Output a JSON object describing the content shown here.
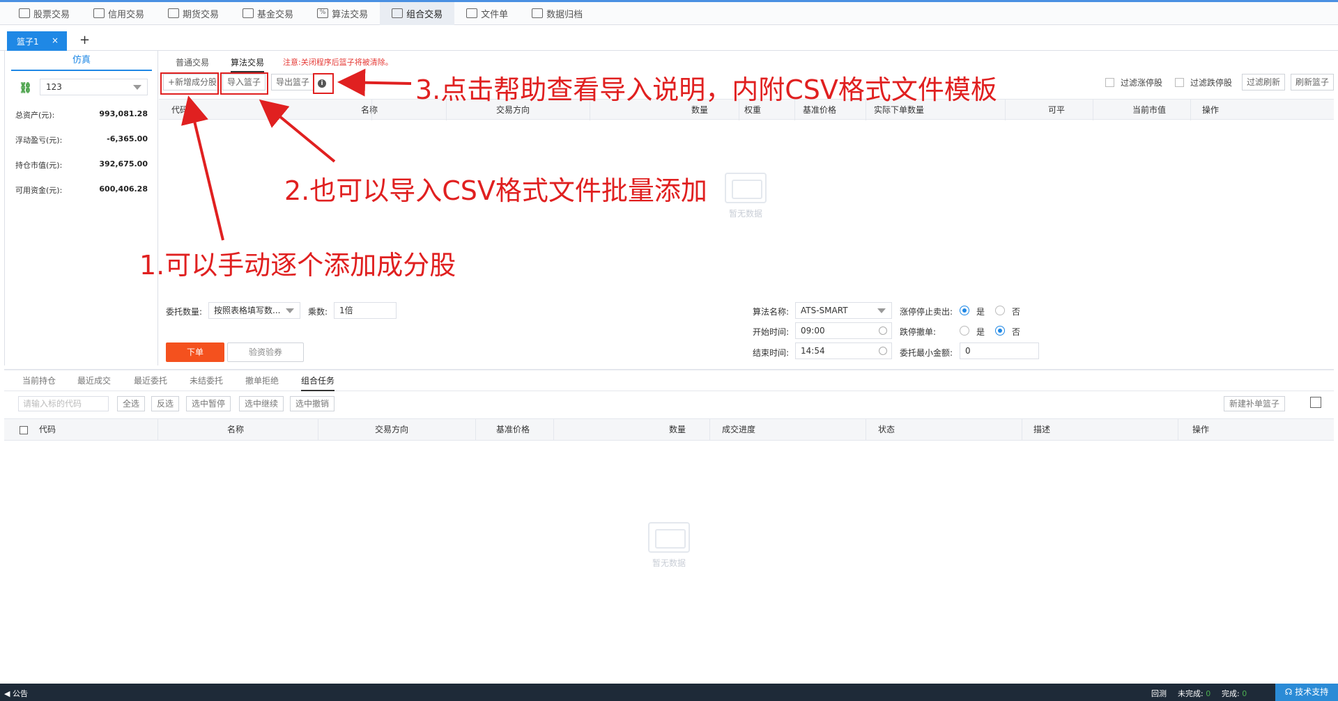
{
  "topnav": [
    {
      "label": "股票交易",
      "icon": "stock-icon"
    },
    {
      "label": "信用交易",
      "icon": "credit-card-icon"
    },
    {
      "label": "期货交易",
      "icon": "futures-chart-icon"
    },
    {
      "label": "基金交易",
      "icon": "fund-chart-icon"
    },
    {
      "label": "算法交易",
      "icon": "percent-icon"
    },
    {
      "label": "组合交易",
      "icon": "basket-icon",
      "active": true
    },
    {
      "label": "文件单",
      "icon": "file-icon"
    },
    {
      "label": "数据归档",
      "icon": "layers-icon"
    }
  ],
  "basket_tab": {
    "label": "篮子1",
    "close": "×",
    "add": "+"
  },
  "left": {
    "title": "仿真",
    "account": "123",
    "stats": [
      {
        "label": "总资产(元):",
        "value": "993,081.28"
      },
      {
        "label": "浮动盈亏(元):",
        "value": "-6,365.00"
      },
      {
        "label": "持仓市值(元):",
        "value": "392,675.00"
      },
      {
        "label": "可用资金(元):",
        "value": "600,406.28"
      }
    ]
  },
  "subtabs": {
    "normal": "普通交易",
    "algo": "算法交易",
    "notice": "注意:关闭程序后篮子将被清除。"
  },
  "toolbar": {
    "add": "+新增成分股",
    "import": "导入篮子",
    "export": "导出篮子",
    "info": "i",
    "filter_up": "过滤涨停股",
    "filter_down": "过滤跌停股",
    "filter_refresh": "过滤刷新",
    "refresh_basket": "刷新篮子"
  },
  "grid_columns": [
    "代码",
    "名称",
    "交易方向",
    "数量",
    "权重",
    "基准价格",
    "实际下单数量",
    "可平",
    "当前市值",
    "操作"
  ],
  "empty_text": "暂无数据",
  "order_form": {
    "qty_label": "委托数量:",
    "qty_value": "按照表格填写数...",
    "mult_label": "乘数:",
    "mult_value": "1倍",
    "algo_label": "算法名称:",
    "algo_value": "ATS-SMART",
    "start_label": "开始时间:",
    "start_value": "09:00",
    "end_label": "结束时间:",
    "end_value": "14:54",
    "limit_up_label": "涨停停止卖出:",
    "limit_down_label": "跌停撤单:",
    "min_amount_label": "委托最小金额:",
    "min_amount_value": "0",
    "yes": "是",
    "no": "否",
    "submit": "下单",
    "verify": "验资验券"
  },
  "bottom_tabs": [
    "当前持仓",
    "最近成交",
    "最近委托",
    "未结委托",
    "撤单拒绝",
    "组合任务"
  ],
  "bottom_toolbar": {
    "placeholder": "请输入标的代码",
    "select_all": "全选",
    "invert": "反选",
    "pause": "选中暂停",
    "resume": "选中继续",
    "cancel": "选中撤销",
    "new_basket": "新建补单篮子"
  },
  "bottom_columns": [
    "代码",
    "名称",
    "交易方向",
    "基准价格",
    "数量",
    "成交进度",
    "状态",
    "描述",
    "操作"
  ],
  "statusbar": {
    "notice": "公告",
    "rollback": "回测",
    "unfinished_label": "未完成:",
    "unfinished": "0",
    "finished_label": "完成:",
    "finished": "0",
    "support": "技术支持"
  },
  "annotations": {
    "a1": "1.可以手动逐个添加成分股",
    "a2": "2.也可以导入CSV格式文件批量添加",
    "a3": "3.点击帮助查看导入说明，内附CSV格式文件模板"
  }
}
